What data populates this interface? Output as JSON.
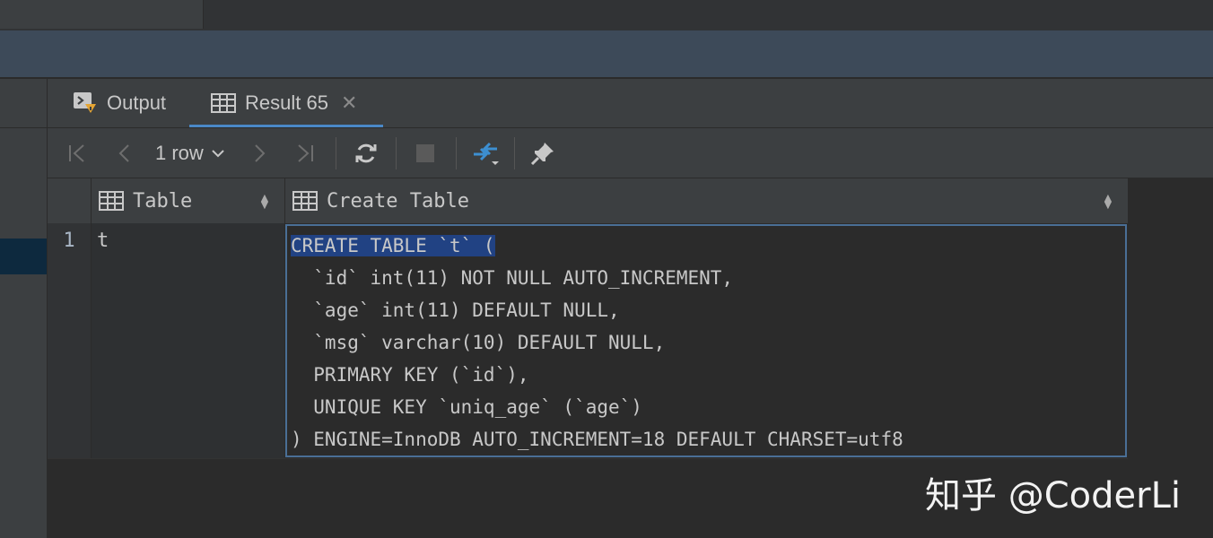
{
  "tabs": {
    "output_label": "Output",
    "result_label": "Result 65"
  },
  "toolbar": {
    "rows_label": "1 row"
  },
  "grid": {
    "columns": [
      "Table",
      "Create Table"
    ],
    "row_number": "1",
    "table_value": "t",
    "create_table_lines": [
      "CREATE TABLE `t` (",
      "  `id` int(11) NOT NULL AUTO_INCREMENT,",
      "  `age` int(11) DEFAULT NULL,",
      "  `msg` varchar(10) DEFAULT NULL,",
      "  PRIMARY KEY (`id`),",
      "  UNIQUE KEY `uniq_age` (`age`)",
      ") ENGINE=InnoDB AUTO_INCREMENT=18 DEFAULT CHARSET=utf8"
    ]
  },
  "watermark": "知乎 @CoderLi",
  "colors": {
    "accent": "#4a88c7",
    "selection": "#214283",
    "background": "#2b2b2b",
    "panel": "#3c3f41"
  }
}
